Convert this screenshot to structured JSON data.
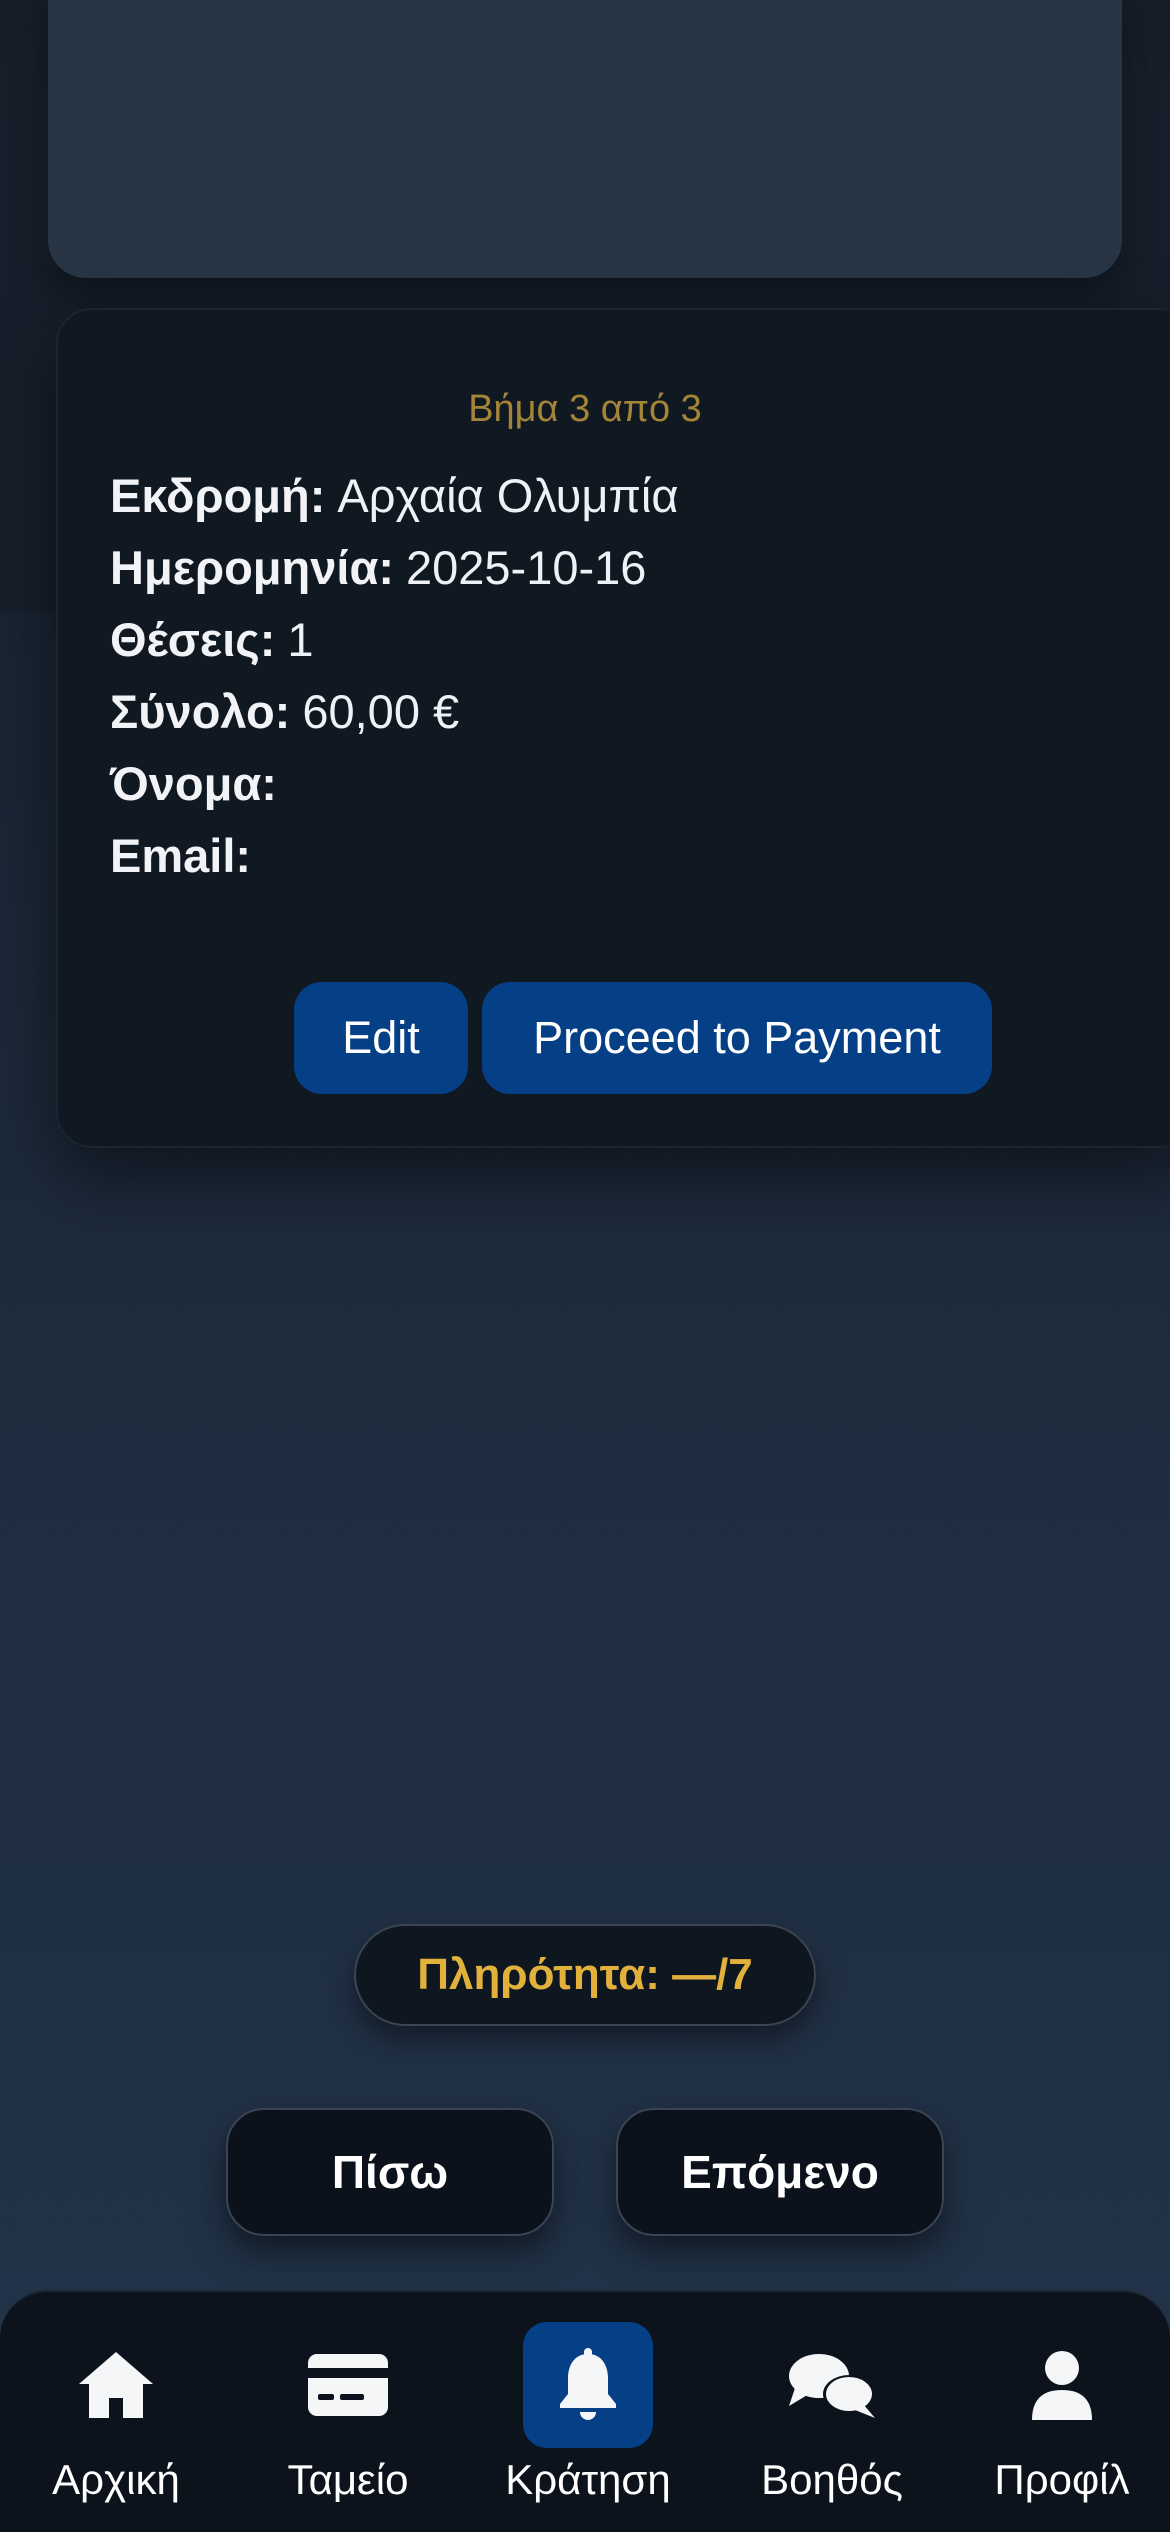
{
  "summary": {
    "step_text": "Βήμα 3 από 3",
    "rows": [
      {
        "label": "Εκδρομή:",
        "value": "Αρχαία Ολυμπία"
      },
      {
        "label": "Ημερομηνία:",
        "value": "2025-10-16"
      },
      {
        "label": "Θέσεις:",
        "value": "1"
      },
      {
        "label": "Σύνολο:",
        "value": "60,00 €"
      },
      {
        "label": "Όνομα:",
        "value": ""
      },
      {
        "label": "Email:",
        "value": ""
      }
    ],
    "edit_label": "Edit",
    "proceed_label": "Proceed to Payment"
  },
  "completeness": {
    "text": "Πληρότητα: —/7"
  },
  "navigation": {
    "back_label": "Πίσω",
    "next_label": "Επόμενο"
  },
  "tabbar": {
    "items": [
      {
        "label": "Αρχική",
        "icon": "home-icon"
      },
      {
        "label": "Ταμείο",
        "icon": "credit-card-icon"
      },
      {
        "label": "Κράτηση",
        "icon": "bell-icon",
        "active": true
      },
      {
        "label": "Βοηθός",
        "icon": "chat-bubbles-icon"
      },
      {
        "label": "Προφίλ",
        "icon": "user-icon"
      }
    ]
  },
  "colors": {
    "accent_blue": "#053f86",
    "step_gold": "#a48436",
    "pill_gold": "#e2b13c"
  }
}
